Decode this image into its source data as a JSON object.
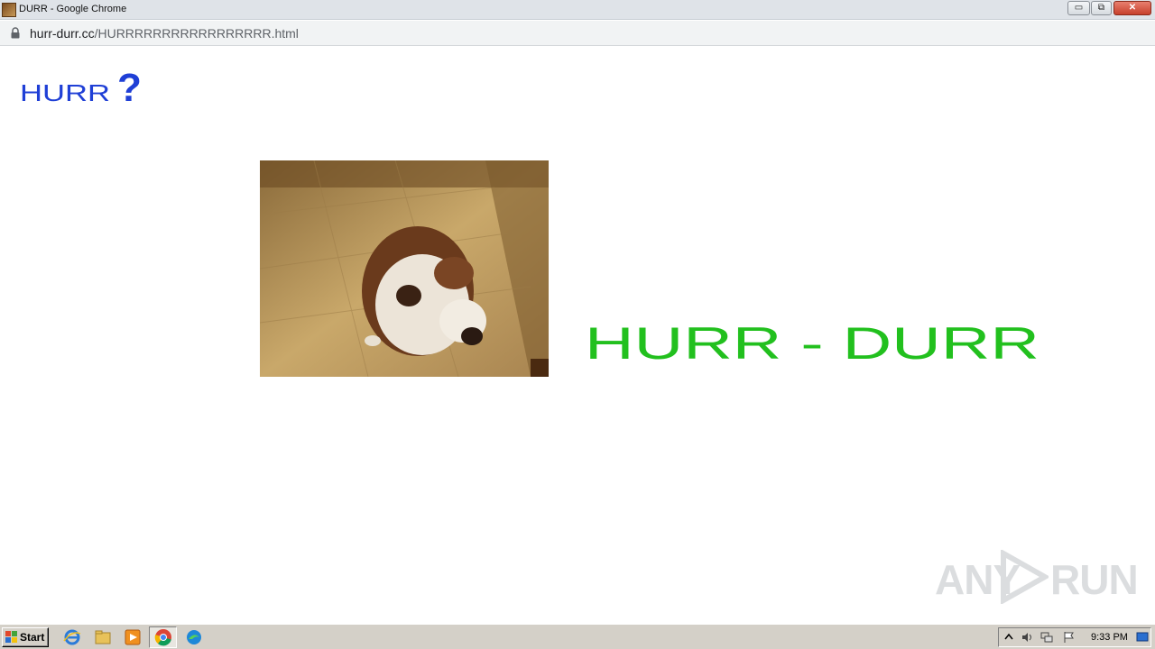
{
  "window": {
    "title": "DURR - Google Chrome",
    "min_label": "▭",
    "max_label": "⧉",
    "close_label": "✕"
  },
  "address_bar": {
    "host": "hurr-durr.cc",
    "path": "/HURRRRRRRRRRRRRRRRR.html"
  },
  "page": {
    "logo_text": "HURR",
    "logo_mark": "?",
    "logo_color": "#1f3fd6",
    "banner_text": "HURR - DURR",
    "banner_color": "#22c01e",
    "image_icon": "bulldog-photo"
  },
  "watermark": {
    "left_text": "ANY",
    "right_text": "RUN"
  },
  "taskbar": {
    "start_label": "Start",
    "apps": [
      "internet-explorer-icon",
      "folder-icon",
      "media-player-icon",
      "chrome-icon",
      "edge-icon"
    ],
    "clock": "9:33 PM"
  }
}
